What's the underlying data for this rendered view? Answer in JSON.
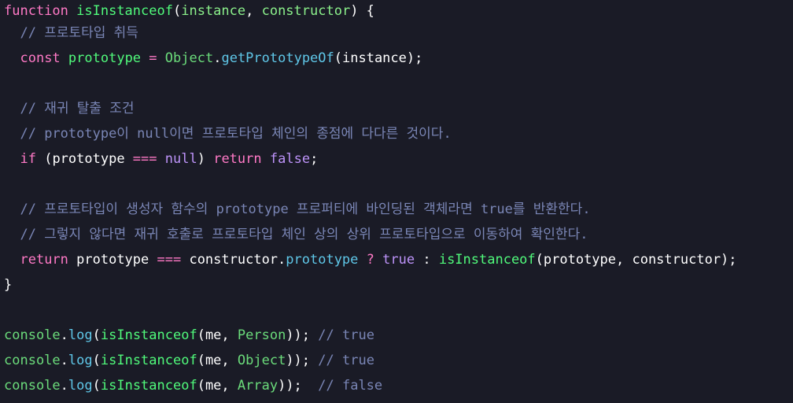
{
  "lines": [
    {
      "tokens": [
        [
          "kw",
          "function"
        ],
        [
          "id",
          " "
        ],
        [
          "fn",
          "isInstanceof"
        ],
        [
          "id",
          "("
        ],
        [
          "prm",
          "instance"
        ],
        [
          "id",
          ", "
        ],
        [
          "prm",
          "constructor"
        ],
        [
          "id",
          ") {"
        ]
      ]
    },
    {
      "tokens": [
        [
          "id",
          "  "
        ],
        [
          "cmt",
          "// 프로토타입 취득"
        ]
      ]
    },
    {
      "tokens": [
        [
          "id",
          "  "
        ],
        [
          "kw",
          "const"
        ],
        [
          "id",
          " "
        ],
        [
          "fn",
          "prototype"
        ],
        [
          "id",
          " "
        ],
        [
          "op",
          "="
        ],
        [
          "id",
          " "
        ],
        [
          "cls",
          "Object"
        ],
        [
          "id",
          "."
        ],
        [
          "mth",
          "getPrototypeOf"
        ],
        [
          "id",
          "(instance);"
        ]
      ]
    },
    {
      "tokens": [
        [
          "id",
          " "
        ]
      ]
    },
    {
      "tokens": [
        [
          "id",
          "  "
        ],
        [
          "cmt",
          "// 재귀 탈출 조건"
        ]
      ]
    },
    {
      "tokens": [
        [
          "id",
          "  "
        ],
        [
          "cmt",
          "// prototype이 null이면 프로토타입 체인의 종점에 다다른 것이다."
        ]
      ]
    },
    {
      "tokens": [
        [
          "id",
          "  "
        ],
        [
          "kw",
          "if"
        ],
        [
          "id",
          " (prototype "
        ],
        [
          "op",
          "==="
        ],
        [
          "id",
          " "
        ],
        [
          "bool",
          "null"
        ],
        [
          "id",
          ") "
        ],
        [
          "kw",
          "return"
        ],
        [
          "id",
          " "
        ],
        [
          "bool",
          "false"
        ],
        [
          "id",
          ";"
        ]
      ]
    },
    {
      "tokens": [
        [
          "id",
          " "
        ]
      ]
    },
    {
      "tokens": [
        [
          "id",
          "  "
        ],
        [
          "cmt",
          "// 프로토타입이 생성자 함수의 prototype 프로퍼티에 바인딩된 객체라면 true를 반환한다."
        ]
      ]
    },
    {
      "tokens": [
        [
          "id",
          "  "
        ],
        [
          "cmt",
          "// 그렇지 않다면 재귀 호출로 프로토타입 체인 상의 상위 프로토타입으로 이동하여 확인한다."
        ]
      ]
    },
    {
      "tokens": [
        [
          "id",
          "  "
        ],
        [
          "kw",
          "return"
        ],
        [
          "id",
          " prototype "
        ],
        [
          "op",
          "==="
        ],
        [
          "id",
          " constructor."
        ],
        [
          "mth",
          "prototype"
        ],
        [
          "id",
          " "
        ],
        [
          "op",
          "?"
        ],
        [
          "id",
          " "
        ],
        [
          "bool",
          "true"
        ],
        [
          "id",
          " : "
        ],
        [
          "fn",
          "isInstanceof"
        ],
        [
          "id",
          "(prototype, constructor);"
        ]
      ]
    },
    {
      "tokens": [
        [
          "id",
          "}"
        ]
      ]
    },
    {
      "tokens": [
        [
          "id",
          " "
        ]
      ]
    },
    {
      "tokens": [
        [
          "cls",
          "console"
        ],
        [
          "id",
          "."
        ],
        [
          "mth",
          "log"
        ],
        [
          "id",
          "("
        ],
        [
          "fn",
          "isInstanceof"
        ],
        [
          "id",
          "(me, "
        ],
        [
          "cls",
          "Person"
        ],
        [
          "id",
          "));"
        ],
        [
          "id",
          " "
        ],
        [
          "cmt",
          "// true"
        ]
      ]
    },
    {
      "tokens": [
        [
          "cls",
          "console"
        ],
        [
          "id",
          "."
        ],
        [
          "mth",
          "log"
        ],
        [
          "id",
          "("
        ],
        [
          "fn",
          "isInstanceof"
        ],
        [
          "id",
          "(me, "
        ],
        [
          "cls",
          "Object"
        ],
        [
          "id",
          "));"
        ],
        [
          "id",
          " "
        ],
        [
          "cmt",
          "// true"
        ]
      ]
    },
    {
      "tokens": [
        [
          "cls",
          "console"
        ],
        [
          "id",
          "."
        ],
        [
          "mth",
          "log"
        ],
        [
          "id",
          "("
        ],
        [
          "fn",
          "isInstanceof"
        ],
        [
          "id",
          "(me, "
        ],
        [
          "cls",
          "Array"
        ],
        [
          "id",
          "));  "
        ],
        [
          "cmt",
          "// false"
        ]
      ]
    }
  ],
  "colors": {
    "background": "#1a1b26",
    "keyword": "#ff79c6",
    "function": "#50fa7b",
    "comment": "#7a86b6",
    "boolean": "#bd93f9"
  }
}
